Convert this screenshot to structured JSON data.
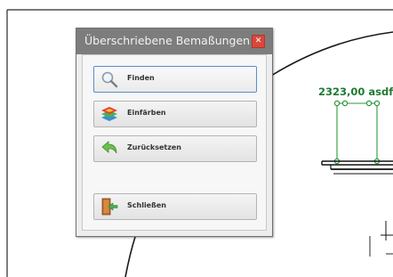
{
  "dialog": {
    "title": "Überschriebene Bemaßungen",
    "close_icon": "close-icon",
    "buttons": [
      {
        "label": "Finden",
        "icon": "magnifier-icon"
      },
      {
        "label": "Einfärben",
        "icon": "color-layers-icon"
      },
      {
        "label": "Zurücksetzen",
        "icon": "undo-arrow-icon"
      },
      {
        "label": "Schließen",
        "icon": "exit-door-icon"
      }
    ]
  },
  "drawing": {
    "dimension_text": "2323,00 asdf",
    "dimension_color": "#1f7a32"
  },
  "colors": {
    "titlebar": "#7d7d7d",
    "close_button": "#d9473b",
    "focus_border": "#5a8ec8"
  }
}
